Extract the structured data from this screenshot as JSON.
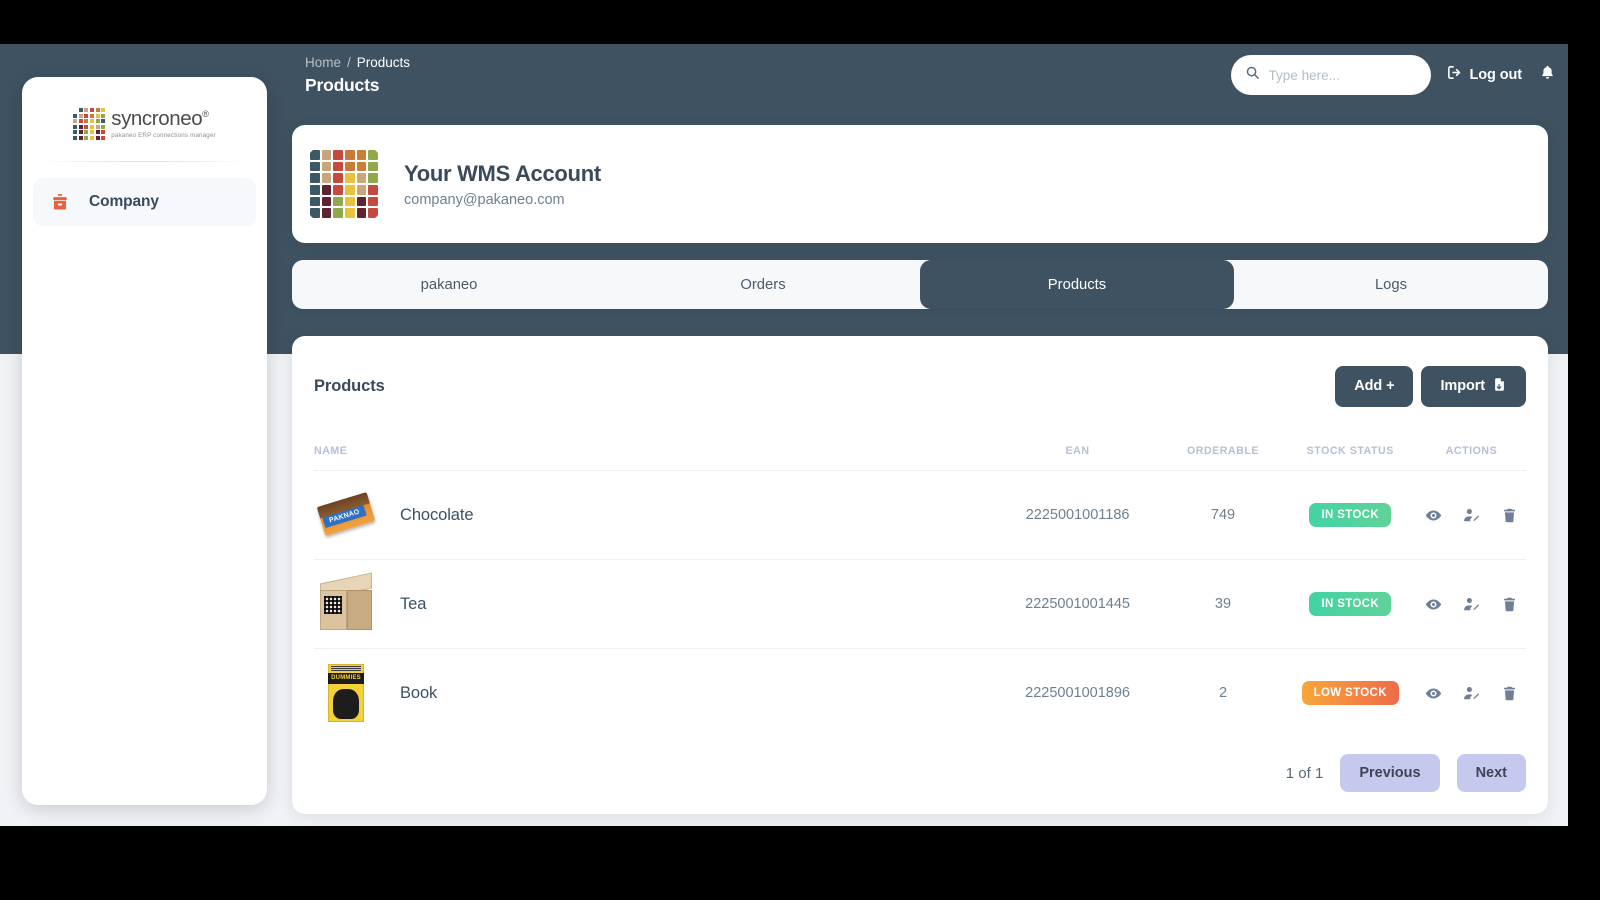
{
  "sidebar": {
    "logo": {
      "word": "syncroneo",
      "registered": "®",
      "tagline": "pakaneo ERP connections manager"
    },
    "nav": [
      {
        "label": "Company",
        "icon": "briefcase-icon",
        "active": true
      }
    ]
  },
  "topbar": {
    "breadcrumb": {
      "home": "Home",
      "separator": "/",
      "current": "Products"
    },
    "page_title": "Products",
    "search": {
      "placeholder": "Type here...",
      "value": "",
      "icon": "search-icon"
    },
    "logout": {
      "label": "Log out",
      "icon": "logout-icon"
    },
    "notifications": {
      "icon": "bell-icon"
    }
  },
  "account": {
    "name": "Your WMS Account",
    "email": "company@pakaneo.com",
    "avatar_icon": "color-grid-avatar",
    "avatar_colors": [
      "#3c5766",
      "#c8a57a",
      "#c44a3f",
      "#c87a3a",
      "#c87f37",
      "#8fa84a",
      "#3c5766",
      "#c8a57a",
      "#c44a3f",
      "#c87a3a",
      "#c87f37",
      "#8fa84a",
      "#3c5766",
      "#c8a57a",
      "#c44a3f",
      "#e8c23f",
      "#c8a57a",
      "#8fa84a",
      "#3c5766",
      "#5e2230",
      "#c44a3f",
      "#e8c23f",
      "#c8a57a",
      "#c44a3f",
      "#3c5766",
      "#5e2230",
      "#8fa84a",
      "#e8c23f",
      "#5e2230",
      "#c44a3f",
      "#3c5766",
      "#5e2230",
      "#8fa84a",
      "#e8c23f",
      "#5e2230",
      "#c44a3f"
    ]
  },
  "tabs": [
    {
      "label": "pakaneo",
      "active": false
    },
    {
      "label": "Orders",
      "active": false
    },
    {
      "label": "Products",
      "active": true
    },
    {
      "label": "Logs",
      "active": false
    }
  ],
  "panel": {
    "title": "Products",
    "add_label": "Add +",
    "import_label": "Import",
    "import_icon": "file-import-icon"
  },
  "table": {
    "columns": [
      "NAME",
      "EAN",
      "ORDERABLE",
      "STOCK STATUS",
      "ACTIONS"
    ],
    "rows": [
      {
        "name": "Chocolate",
        "thumb": "chocolate-bar-image",
        "thumb_text": "PAKNAO",
        "ean": "2225001001186",
        "orderable": "749",
        "status": "IN STOCK",
        "status_kind": "in-stock",
        "actions": [
          "view-icon",
          "assign-user-icon",
          "delete-icon"
        ]
      },
      {
        "name": "Tea",
        "thumb": "cardboard-box-image",
        "thumb_text": "",
        "ean": "2225001001445",
        "orderable": "39",
        "status": "IN STOCK",
        "status_kind": "in-stock",
        "actions": [
          "view-icon",
          "assign-user-icon",
          "delete-icon"
        ]
      },
      {
        "name": "Book",
        "thumb": "book-cover-image",
        "thumb_text": "DUMMIES",
        "ean": "2225001001896",
        "orderable": "2",
        "status": "LOW STOCK",
        "status_kind": "low-stock",
        "actions": [
          "view-icon",
          "assign-user-icon",
          "delete-icon"
        ]
      }
    ]
  },
  "pagination": {
    "indicator": "1 of 1",
    "previous_label": "Previous",
    "next_label": "Next"
  },
  "colors": {
    "header": "#3e5261",
    "accent_orange": "#e8603c",
    "in_stock": "#43d3a4",
    "low_stock": "#f08040",
    "page_button": "#c6c9ee"
  }
}
